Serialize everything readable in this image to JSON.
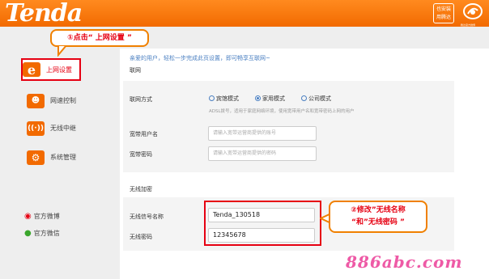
{
  "header": {
    "logo": "Tenda",
    "badge_line1": "也安装",
    "badge_line2": "用腾达",
    "logo2_text": "腾达官方微博"
  },
  "callouts": {
    "step1": "①点击“ 上网设置 ”",
    "step2_line1": "②修改”无线名称",
    "step2_line2": "“和”无线密码 ”"
  },
  "sidebar": {
    "items": [
      {
        "label": "上网设置",
        "icon": "internet-explorer-icon",
        "active": true
      },
      {
        "label": "网速控制",
        "icon": "users-icon",
        "active": false
      },
      {
        "label": "无线中继",
        "icon": "wifi-relay-icon",
        "active": false
      },
      {
        "label": "系统管理",
        "icon": "gear-icon",
        "active": false
      }
    ],
    "links": [
      {
        "label": "官方微博",
        "icon": "weibo-icon"
      },
      {
        "label": "官方微信",
        "icon": "wechat-icon"
      }
    ]
  },
  "main": {
    "intro": "亲爱的用户，轻松一步完成此页设置，即可畅享互联网~",
    "network_section": "联网",
    "connection_label": "联网方式",
    "modes": [
      {
        "label": "宾馆模式",
        "selected": false
      },
      {
        "label": "家用模式",
        "selected": true
      },
      {
        "label": "公司模式",
        "selected": false
      }
    ],
    "adsl_hint": "ADSL拨号，适用于家庭网络环境，使用宽带用户名和宽带密码上网的用户",
    "broadband_user_label": "宽带用户名",
    "broadband_user_placeholder": "请输入宽带运营商提供的账号",
    "broadband_pass_label": "宽带密码",
    "broadband_pass_placeholder": "请输入宽带运营商提供的密码",
    "wireless_section": "无线加密",
    "ssid_label": "无线信号名称",
    "ssid_value": "Tenda_130518",
    "wifi_pass_label": "无线密码",
    "wifi_pass_value": "12345678"
  },
  "watermark": "886abc.com",
  "colors": {
    "brand": "#f26a00",
    "highlight": "#e60012",
    "link": "#4a7fc1"
  }
}
